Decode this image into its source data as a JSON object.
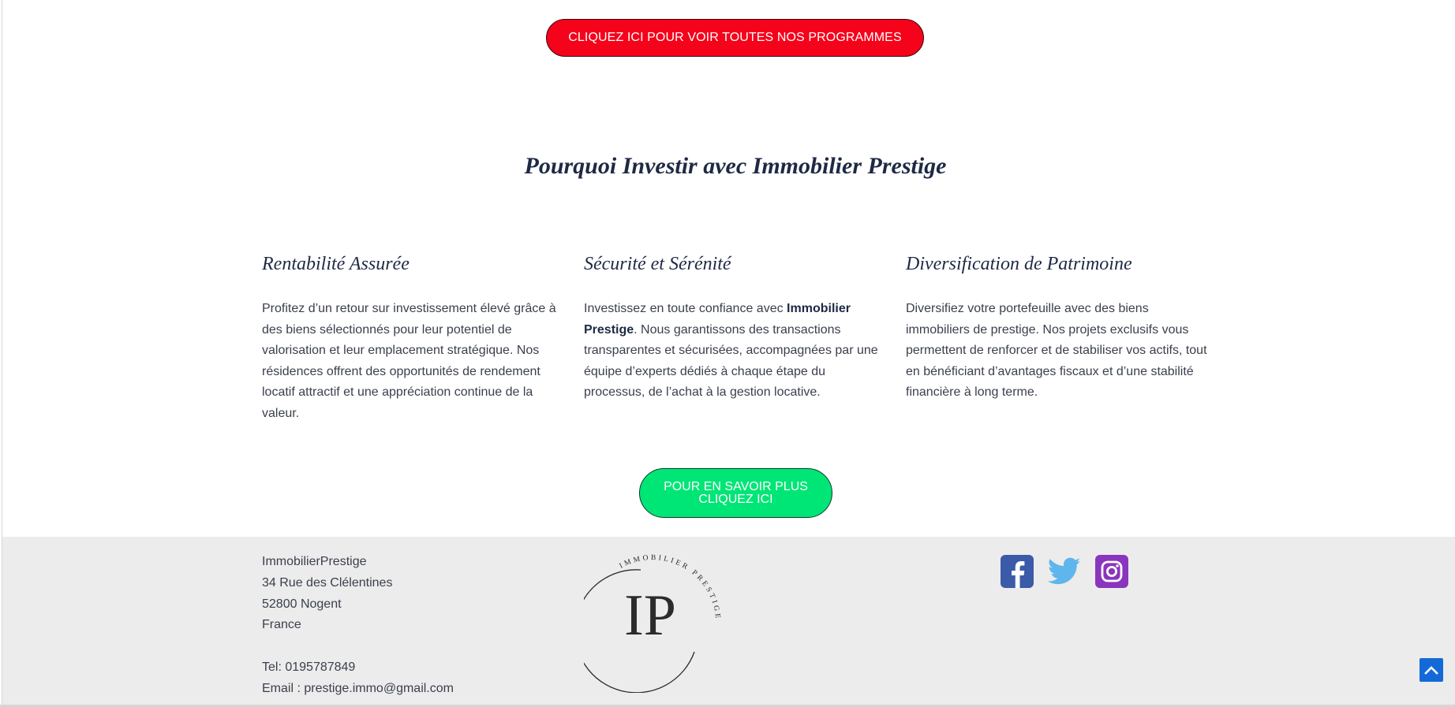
{
  "buttons": {
    "programmes": "CLIQUEZ ICI POUR VOIR TOUTES NOS PROGRAMMES",
    "savoir_line1": "POUR EN SAVOIR PLUS",
    "savoir_line2": "CLIQUEZ ICI"
  },
  "section": {
    "title": "Pourquoi Investir avec Immobilier Prestige"
  },
  "columns": [
    {
      "title": "Rentabilité Assurée",
      "text": "Profitez d’un retour sur investissement élevé grâce à des biens sélectionnés pour leur potentiel de valorisation et leur emplacement stratégique. Nos résidences offrent des opportunités de rendement locatif attractif et une appréciation continue de la valeur."
    },
    {
      "title": "Sécurité et Sérénité",
      "text_before": "Investissez en toute confiance avec ",
      "text_bold": "Immobilier Prestige",
      "text_after": ". Nous garantissons des transactions transparentes et sécurisées, accompagnées par une équipe d’experts dédiés à chaque étape du processus, de l’achat à la gestion locative."
    },
    {
      "title": "Diversification de Patrimoine",
      "text": "Diversifiez votre portefeuille avec des biens immobiliers de prestige. Nos projets exclusifs vous permettent de renforcer et de stabiliser vos actifs, tout en bénéficiant d’avantages fiscaux et d’une stabilité financière à long terme."
    }
  ],
  "footer": {
    "company": "ImmobilierPrestige",
    "street": "34 Rue des Clélentines",
    "city": "52800 Nogent",
    "country": "France",
    "tel": "Tel: 0195787849",
    "email": "Email : prestige.immo@gmail.com",
    "logo_initials": "IP",
    "logo_arc_text": "IMMOBILIER PRESTIGE"
  },
  "social": [
    "facebook-icon",
    "twitter-icon",
    "instagram-icon"
  ],
  "colors": {
    "red_button": "#f5021b",
    "green_button": "#00e676",
    "footer_bg": "#ececec",
    "heading": "#1e2a44",
    "facebook": "#3b5ba8",
    "twitter": "#5fb6ec",
    "instagram": "#8a35bd",
    "scroll_top": "#1469d8"
  }
}
